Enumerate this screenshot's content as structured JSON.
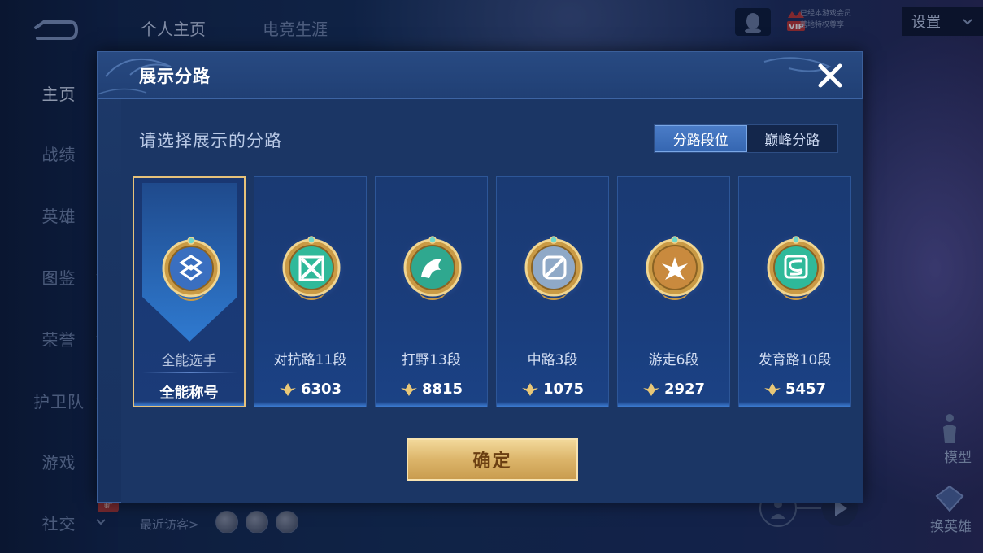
{
  "sidebar": {
    "items": [
      {
        "label": "主页",
        "active": true,
        "chevron": false,
        "new": false
      },
      {
        "label": "战绩",
        "active": false,
        "chevron": false,
        "new": false
      },
      {
        "label": "英雄",
        "active": false,
        "chevron": false,
        "new": false
      },
      {
        "label": "图鉴",
        "active": false,
        "chevron": true,
        "new": false
      },
      {
        "label": "荣誉",
        "active": false,
        "chevron": true,
        "new": true
      },
      {
        "label": "护卫队",
        "active": false,
        "chevron": true,
        "new": false
      },
      {
        "label": "游戏",
        "active": false,
        "chevron": true,
        "new": false
      },
      {
        "label": "社交",
        "active": false,
        "chevron": true,
        "new": true
      }
    ],
    "new_badge": "新"
  },
  "top_tabs": [
    "个人主页",
    "电竞生涯"
  ],
  "topbar": {
    "settings_label": "设置",
    "vip_label": "VIP",
    "vip_line1": "已经本游戏会员",
    "vip_line2": "营地特权尊享"
  },
  "footer": {
    "recent_visitors": "最近访客>",
    "model_label": "模型",
    "swap_hero_label": "换英雄"
  },
  "modal": {
    "title": "展示分路",
    "subtitle": "请选择展示的分路",
    "segments": [
      {
        "label": "分路段位",
        "active": true
      },
      {
        "label": "巅峰分路",
        "active": false
      }
    ],
    "cards": [
      {
        "label": "全能选手",
        "value": "全能称号",
        "emblem": "all-round-emblem-icon",
        "color": "#3a6fc0",
        "selected": true,
        "has_points": false
      },
      {
        "label": "对抗路11段",
        "value": "6303",
        "emblem": "clash-lane-emblem-icon",
        "color": "#2fb99a",
        "selected": false,
        "has_points": true
      },
      {
        "label": "打野13段",
        "value": "8815",
        "emblem": "jungle-emblem-icon",
        "color": "#2fa88f",
        "selected": false,
        "has_points": true
      },
      {
        "label": "中路3段",
        "value": "1075",
        "emblem": "mid-lane-emblem-icon",
        "color": "#8fa9c7",
        "selected": false,
        "has_points": true
      },
      {
        "label": "游走6段",
        "value": "2927",
        "emblem": "roam-emblem-icon",
        "color": "#c98a3e",
        "selected": false,
        "has_points": true
      },
      {
        "label": "发育路10段",
        "value": "5457",
        "emblem": "farm-lane-emblem-icon",
        "color": "#2fb99a",
        "selected": false,
        "has_points": true
      }
    ],
    "confirm_label": "确定"
  },
  "colors": {
    "gold_accent": "#e7c27a",
    "modal_bg": "#1b3665",
    "segment_active": "#3e72bd"
  }
}
